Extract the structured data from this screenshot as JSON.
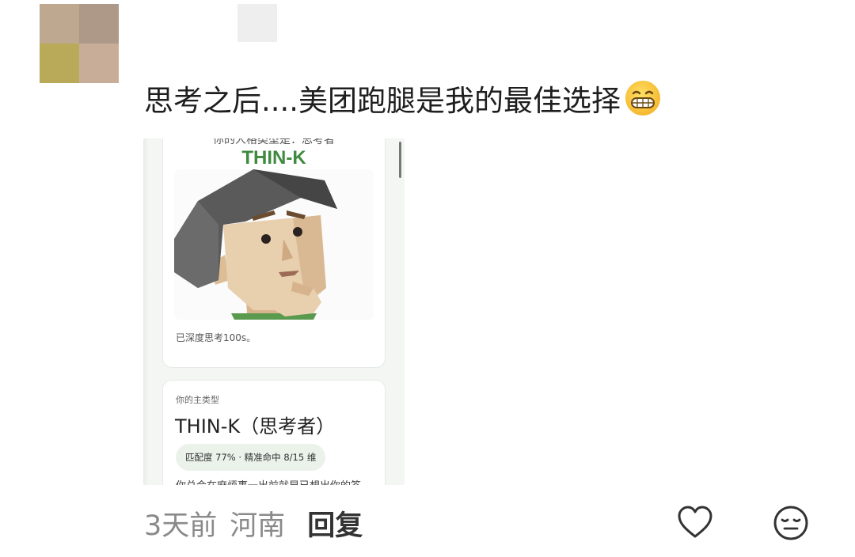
{
  "comment": {
    "text": "思考之后....美团跑腿是我的最佳选择",
    "emoji": "grinning-face"
  },
  "attached_image": {
    "result_line_cut": "你的人格类型是：思考者",
    "type_code": "THIN-K",
    "think_time": "已深度思考100s。",
    "main_type_label": "你的主类型",
    "main_type_title": "THIN-K（思考者）",
    "match_stats": "匹配度 77% · 精准命中 8/15 维",
    "cut_text": "你总会在麻烦事一出前就早已想出你的答"
  },
  "meta": {
    "time": "3天前",
    "location": "河南",
    "reply_label": "回复"
  },
  "colors": {
    "type_green": "#3f8a3f",
    "meta_gray": "#8a8a8a",
    "pill_bg": "#eaf2ea"
  }
}
